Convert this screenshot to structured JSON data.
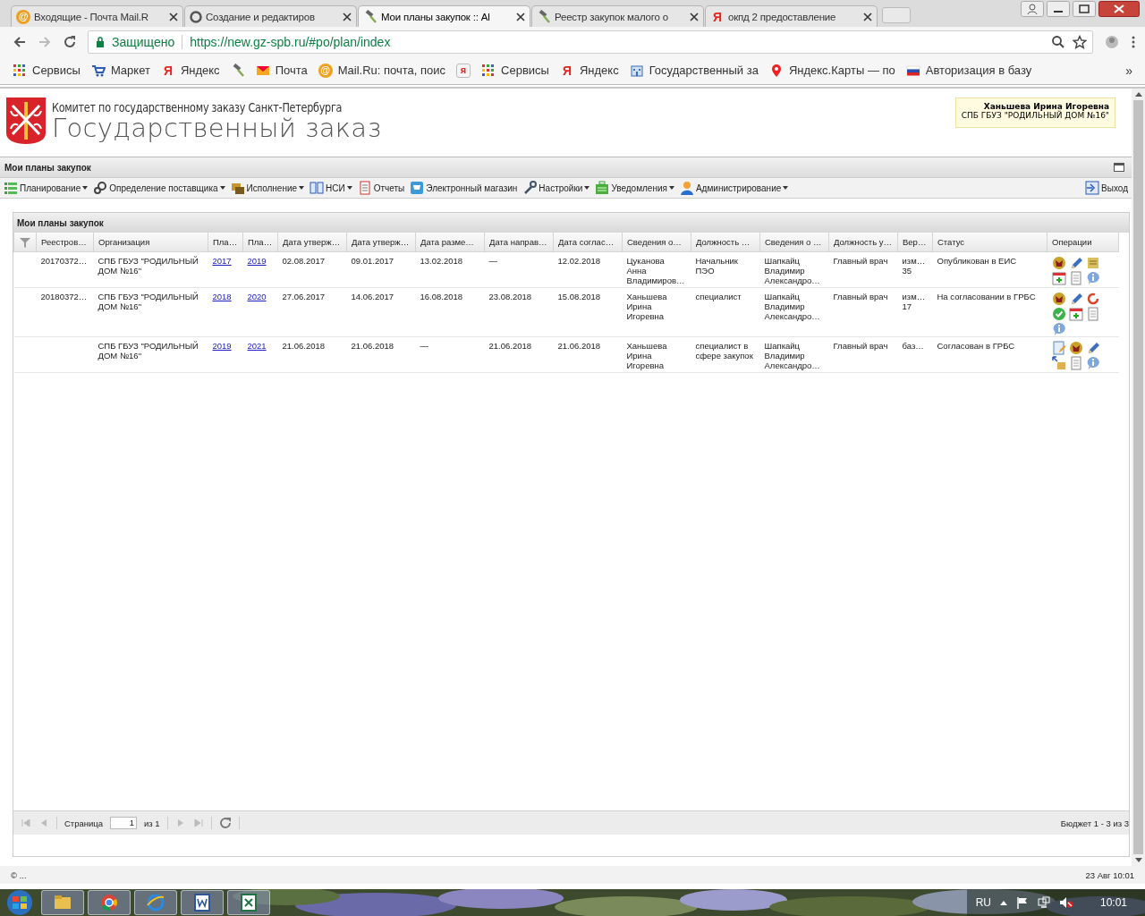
{
  "browser": {
    "tabs": [
      {
        "title": "Входящие - Почта Mail.R",
        "icon_text": "@",
        "selected": false
      },
      {
        "title": "Создание и редактиров",
        "selected": false
      },
      {
        "title": "Мои планы закупок :: Al",
        "selected": true
      },
      {
        "title": "Реестр закупок малого о",
        "selected": false
      },
      {
        "title": "окпд 2 предоставление",
        "icon_text": "Я",
        "selected": false
      }
    ],
    "security": "Защищено",
    "url": "https://new.gz-spb.ru/#po/plan/index",
    "bookmarks": [
      {
        "label": "Сервисы"
      },
      {
        "label": "Маркет"
      },
      {
        "label": "Яндекс",
        "icon_text": "Я"
      },
      {
        "kind": "icon"
      },
      {
        "label": "Почта"
      },
      {
        "label": "Mail.Ru: почта, поис",
        "icon_text": "@"
      },
      {
        "kind": "icon",
        "icon_text": "я"
      },
      {
        "label": "Сервисы"
      },
      {
        "label": "Яндекс",
        "icon_text": "Я"
      },
      {
        "label": "Государственный за"
      },
      {
        "label": "Яндекс.Карты — по"
      },
      {
        "label": "Авторизация в базу"
      }
    ],
    "more": "»"
  },
  "header": {
    "subtitle": "Комитет по государственному заказу Санкт-Петербурга",
    "title": "Государственный заказ",
    "user": {
      "name": "Ханьшева Ирина Игоревна",
      "organization": "СПБ ГБУЗ \"РОДИЛЬНЫЙ ДОМ №16\""
    }
  },
  "panel": {
    "title": "Мои планы закупок",
    "menu": [
      {
        "label": "Планирование",
        "dropdown": true
      },
      {
        "label": "Определение поставщика",
        "dropdown": true
      },
      {
        "label": "Исполнение",
        "dropdown": true
      },
      {
        "label": "НСИ",
        "dropdown": true
      },
      {
        "label": "Отчеты",
        "dropdown": false
      },
      {
        "label": "Электронный магазин",
        "dropdown": false
      },
      {
        "label": "Настройки",
        "dropdown": true
      },
      {
        "label": "Уведомления",
        "dropdown": true
      },
      {
        "label": "Администрирование",
        "dropdown": true
      }
    ],
    "exit": "Выход"
  },
  "grid": {
    "title": "Мои планы закупок",
    "columns": [
      {
        "kind": "filter"
      },
      {
        "label": "Реестров…"
      },
      {
        "label": "Организация"
      },
      {
        "label": "Пла…",
        "kind": "link"
      },
      {
        "label": "Пла…",
        "kind": "link"
      },
      {
        "label": "Дата утверж…"
      },
      {
        "label": "Дата утверж…"
      },
      {
        "label": "Дата разме…"
      },
      {
        "label": "Дата направ…"
      },
      {
        "label": "Дата соглас…"
      },
      {
        "label": "Сведения о…"
      },
      {
        "label": "Должность …"
      },
      {
        "label": "Сведения о …"
      },
      {
        "label": "Должность у…"
      },
      {
        "label": "Вер…"
      },
      {
        "label": "Статус"
      },
      {
        "label": "Операции",
        "kind": "ops"
      }
    ],
    "rows": [
      {
        "registry": "20170372…",
        "organization": "СПБ ГБУЗ \"РОДИЛЬНЫЙ ДОМ №16\"",
        "plan_from": "2017",
        "plan_to": "2019",
        "approved": "02.08.2017",
        "approved_2": "09.01.2017",
        "posted": "13.02.2018",
        "sent": "—",
        "agreed": "12.02.2018",
        "author": "Цуканова\nАнна\nВладимиров…",
        "author_position": "Начальник\nПЭО",
        "approver": "Шапкайц\nВладимир\nАлександро…",
        "approver_position": "Главный врач",
        "version": "изм…\n35",
        "status": "Опубликован в ЕИС",
        "operations": [
          {
            "kind": "emblem"
          },
          {
            "kind": "pencil"
          },
          {
            "kind": "scroll"
          },
          {
            "kind": "calendar"
          },
          {
            "kind": "document"
          },
          {
            "kind": "info"
          }
        ]
      },
      {
        "registry": "20180372…",
        "organization": "СПБ ГБУЗ \"РОДИЛЬНЫЙ ДОМ №16\"",
        "plan_from": "2018",
        "plan_to": "2020",
        "approved": "27.06.2017",
        "approved_2": "14.06.2017",
        "posted": "16.08.2018",
        "sent": "23.08.2018",
        "agreed": "15.08.2018",
        "author": "Ханьшева\nИрина\nИгоревна",
        "author_position": "специалист",
        "approver": "Шапкайц\nВладимир\nАлександро…",
        "approver_position": "Главный врач",
        "version": "изм…\n17",
        "status": "На согласовании в ГРБС",
        "operations": [
          {
            "kind": "emblem"
          },
          {
            "kind": "pencil"
          },
          {
            "kind": "refresh"
          },
          {
            "kind": "check"
          },
          {
            "kind": "calendar"
          },
          {
            "kind": "document"
          },
          {
            "kind": "info"
          }
        ]
      },
      {
        "organization": "СПБ ГБУЗ \"РОДИЛЬНЫЙ ДОМ №16\"",
        "plan_from": "2019",
        "plan_to": "2021",
        "approved": "21.06.2018",
        "approved_2": "21.06.2018",
        "posted": "—",
        "sent": "21.06.2018",
        "agreed": "21.06.2018",
        "author": "Ханьшева\nИрина\nИгоревна",
        "author_position": "специалист в\nсфере закупок",
        "approver": "Шапкайц\nВладимир\nАлександро…",
        "approver_position": "Главный врач",
        "version": "баз…",
        "status": "Согласован в ГРБС",
        "operations": [
          {
            "kind": "doc-edit"
          },
          {
            "kind": "emblem"
          },
          {
            "kind": "pencil"
          },
          {
            "kind": "move"
          },
          {
            "kind": "document"
          },
          {
            "kind": "info"
          }
        ]
      }
    ],
    "paging": {
      "page_label": "Страница",
      "page": "1",
      "of": "из 1",
      "summary": "Бюджет 1 - 3 из 3"
    }
  },
  "footer": {
    "copyright": "© ...",
    "datetime": "23 Авг 10:01"
  },
  "taskbar": {
    "apps": [
      {
        "kind": "explorer"
      },
      {
        "kind": "chrome"
      },
      {
        "kind": "ie"
      },
      {
        "kind": "word"
      },
      {
        "kind": "excel"
      }
    ],
    "language": "RU",
    "time": "10:01"
  }
}
